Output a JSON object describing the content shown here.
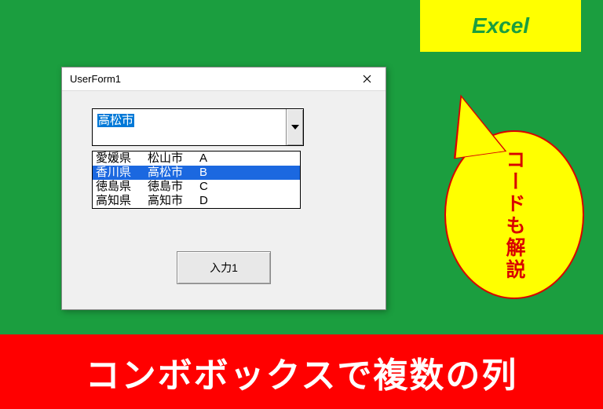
{
  "badge": {
    "label": "Excel"
  },
  "form": {
    "title": "UserForm1",
    "combo_value": "高松市",
    "options": [
      {
        "col1": "愛媛県",
        "col2": "松山市",
        "col3": "A",
        "selected": false
      },
      {
        "col1": "香川県",
        "col2": "高松市",
        "col3": "B",
        "selected": true
      },
      {
        "col1": "徳島県",
        "col2": "徳島市",
        "col3": "C",
        "selected": false
      },
      {
        "col1": "高知県",
        "col2": "高知市",
        "col3": "D",
        "selected": false
      }
    ],
    "button_label": "入力1"
  },
  "bubble": {
    "text": "コードも解説"
  },
  "footer": {
    "text": "コンボボックスで複数の列"
  }
}
